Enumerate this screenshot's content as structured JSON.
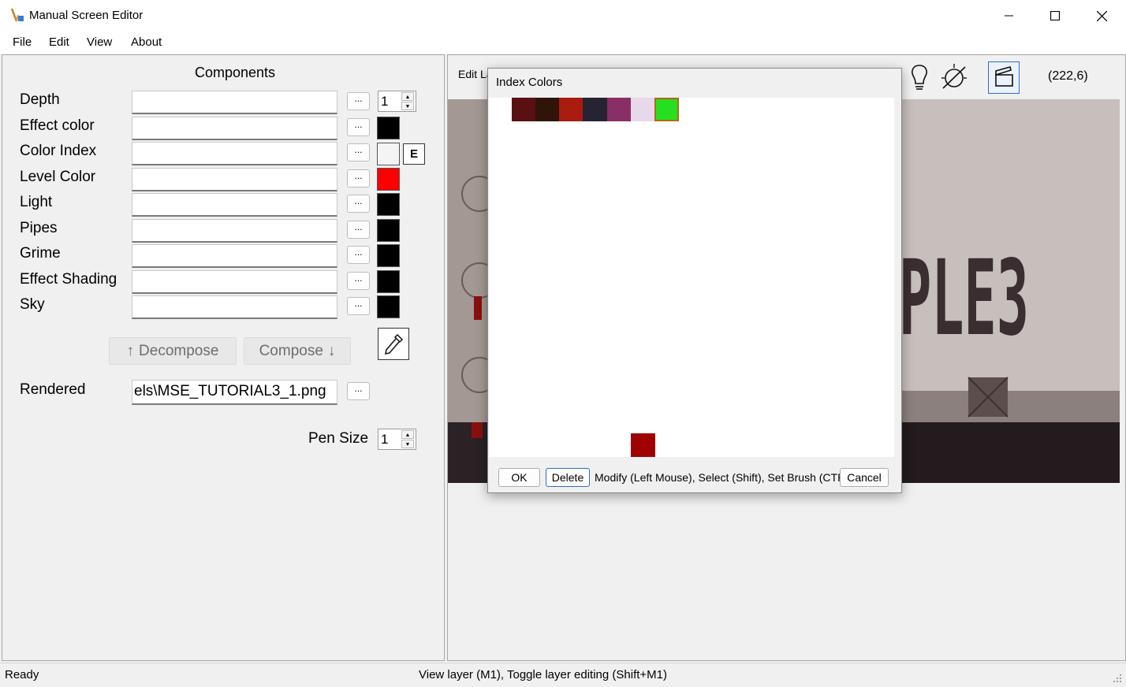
{
  "window": {
    "title": "Manual Screen Editor"
  },
  "menu": [
    "File",
    "Edit",
    "View",
    "About"
  ],
  "components": {
    "title": "Components",
    "rows": [
      {
        "label": "Depth",
        "value": "",
        "swatch": null,
        "spin": "1"
      },
      {
        "label": "Effect color",
        "value": "",
        "swatch": "#000000"
      },
      {
        "label": "Color Index",
        "value": "",
        "swatch": "#f4f4f4",
        "extra_button": "E"
      },
      {
        "label": "Level Color",
        "value": "",
        "swatch": "#ff0000"
      },
      {
        "label": "Light",
        "value": "",
        "swatch": "#000000"
      },
      {
        "label": "Pipes",
        "value": "",
        "swatch": "#000000"
      },
      {
        "label": "Grime",
        "value": "",
        "swatch": "#000000"
      },
      {
        "label": "Effect Shading",
        "value": "",
        "swatch": "#000000"
      },
      {
        "label": "Sky",
        "value": "",
        "swatch": "#000000"
      }
    ],
    "browse_label": "...",
    "decompose_label": "Decompose",
    "decompose_arrow": "↑",
    "compose_label": "Compose",
    "compose_arrow": "↓",
    "rendered_label": "Rendered",
    "rendered_value": "els\\MSE_TUTORIAL3_1.png",
    "pen_size_label": "Pen Size",
    "pen_size_value": "1"
  },
  "editor": {
    "edit_layer_label": "Edit La",
    "coords": "(222,6)",
    "canvas_text": "PLE3"
  },
  "dialog": {
    "title": "Index Colors",
    "palette": [
      "#5a0f12",
      "#2f1409",
      "#aa1c10",
      "#262433",
      "#8a2f66",
      "#e8d8ec",
      "#25e01f"
    ],
    "selected_palette_index": 6,
    "brush_color": "#9e0202",
    "ok_label": "OK",
    "delete_label": "Delete",
    "hint": "Modify (Left Mouse), Select (Shift), Set Brush (CTRL)",
    "cancel_label": "Cancel"
  },
  "status": {
    "left": "Ready",
    "middle": "View layer (M1), Toggle layer editing (Shift+M1)"
  }
}
